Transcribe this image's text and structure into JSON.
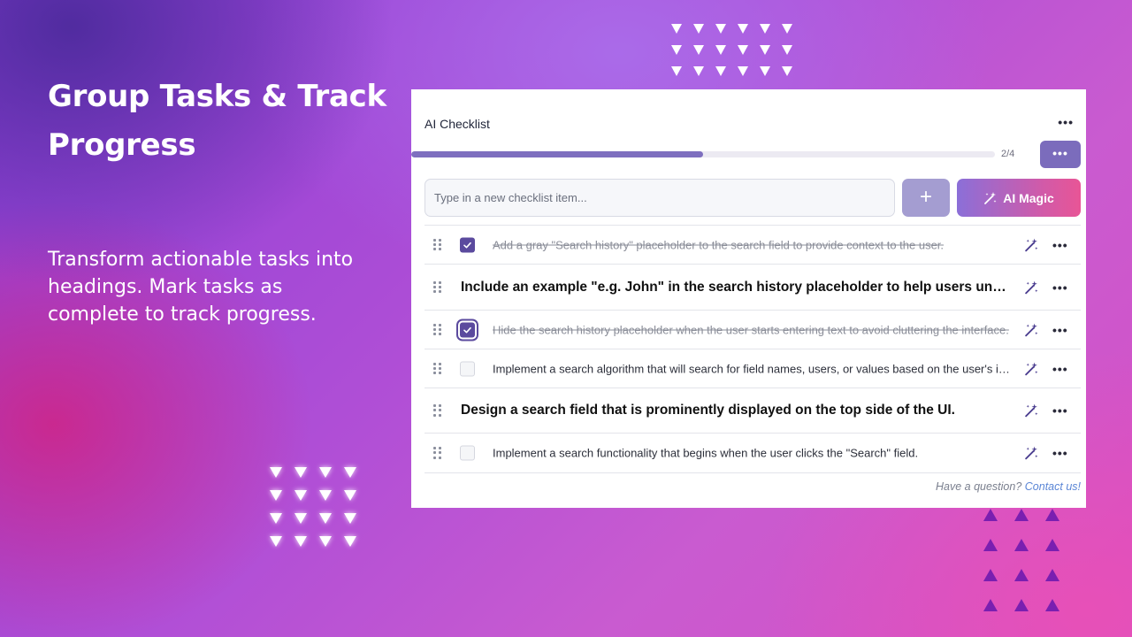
{
  "hero": {
    "title": "Group Tasks & Track Progress",
    "subtitle": "Transform actionable tasks into headings. Mark tasks as complete to track progress."
  },
  "panel": {
    "title": "AI Checklist",
    "menu_icon": "more-horizontal-icon",
    "progress": {
      "completed": 2,
      "total": 4,
      "fraction": 0.5,
      "label": "2/4"
    },
    "input_placeholder": "Type in a new checklist item...",
    "add_button_label": "+",
    "ai_magic_label": "AI Magic",
    "items": [
      {
        "type": "task",
        "checked": true,
        "focused": false,
        "text": "Add a gray \"Search history\" placeholder to the search field to provide context to the user."
      },
      {
        "type": "heading",
        "text": "Include an example \"e.g. John\" in the search history placeholder to help users understand how to use it."
      },
      {
        "type": "task",
        "checked": true,
        "focused": true,
        "text": "Hide the search history placeholder when the user starts entering text to avoid cluttering the interface."
      },
      {
        "type": "task",
        "checked": false,
        "focused": false,
        "text": "Implement a search algorithm that will search for field names, users, or values based on the user's input."
      },
      {
        "type": "heading",
        "text": "Design a search field that is prominently displayed on the top side of the UI."
      },
      {
        "type": "task",
        "checked": false,
        "focused": false,
        "text": "Implement a search functionality that begins when the user clicks the \"Search\" field."
      }
    ],
    "footer_question": "Have a question?",
    "footer_link": "Contact us!"
  },
  "colors": {
    "accent": "#7b6cbc",
    "checkbox": "#5b4a9e",
    "ai_magic_gradient_start": "#8b6fd8",
    "ai_magic_gradient_end": "#e85596",
    "link": "#5b86d6"
  }
}
